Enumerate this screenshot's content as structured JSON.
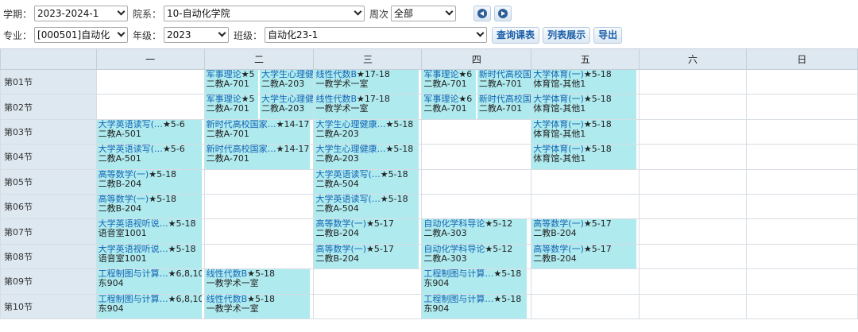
{
  "filters": {
    "term_label": "学期：",
    "term_value": "2023-2024-1",
    "dept_label": "院系：",
    "dept_value": "10-自动化学院",
    "week_label": "周次",
    "week_value": "全部",
    "major_label": "专业：",
    "major_value": "[000501]自动化",
    "grade_label": "年级：",
    "grade_value": "2023",
    "class_label": "班级：",
    "class_value": "自动化23-1",
    "query_btn": "查询课表",
    "list_btn": "列表展示",
    "export_btn": "导出"
  },
  "timetable": {
    "days": [
      "一",
      "二",
      "三",
      "四",
      "五",
      "六",
      "日"
    ],
    "slots": [
      {
        "label": "第01节",
        "cells": [
          [],
          [
            {
              "name": "军事理论",
              "weeks": "★5",
              "room": "二教A-701"
            },
            {
              "name": "大学生心理健",
              "weeks": "",
              "room": "二教A-203"
            }
          ],
          [
            {
              "name": "线性代数B",
              "weeks": "★17-18",
              "room": "一教学术一室"
            }
          ],
          [
            {
              "name": "军事理论",
              "weeks": "★6",
              "room": "二教A-701"
            },
            {
              "name": "新时代高校国",
              "weeks": "",
              "room": "二教A-701"
            }
          ],
          [
            {
              "name": "大学体育(一)",
              "weeks": "★5-18",
              "room": "体育馆-其他1"
            }
          ],
          [],
          []
        ]
      },
      {
        "label": "第02节",
        "cells": [
          [],
          [
            {
              "name": "军事理论",
              "weeks": "★5",
              "room": "二教A-701"
            },
            {
              "name": "大学生心理健",
              "weeks": "",
              "room": "二教A-203"
            }
          ],
          [
            {
              "name": "线性代数B",
              "weeks": "★17-18",
              "room": "一教学术一室"
            }
          ],
          [
            {
              "name": "军事理论",
              "weeks": "★6",
              "room": "二教A-701"
            },
            {
              "name": "新时代高校国",
              "weeks": "",
              "room": "二教A-701"
            }
          ],
          [
            {
              "name": "大学体育(一)",
              "weeks": "★5-18",
              "room": "体育馆-其他1"
            }
          ],
          [],
          []
        ]
      },
      {
        "label": "第03节",
        "cells": [
          [
            {
              "name": "大学英语读写(…",
              "weeks": "★5-6",
              "room": "二教A-501"
            }
          ],
          [
            {
              "name": "新时代高校国家…",
              "weeks": "★14-17",
              "room": "二教A-701"
            }
          ],
          [
            {
              "name": "大学生心理健康…",
              "weeks": "★5-18",
              "room": "二教A-203"
            }
          ],
          [],
          [
            {
              "name": "大学体育(一)",
              "weeks": "★5-18",
              "room": "体育馆-其他1"
            }
          ],
          [],
          []
        ]
      },
      {
        "label": "第04节",
        "cells": [
          [
            {
              "name": "大学英语读写(…",
              "weeks": "★5-6",
              "room": "二教A-501"
            }
          ],
          [
            {
              "name": "新时代高校国家…",
              "weeks": "★14-17",
              "room": "二教A-701"
            }
          ],
          [
            {
              "name": "大学生心理健康…",
              "weeks": "★5-18",
              "room": "二教A-203"
            }
          ],
          [],
          [
            {
              "name": "大学体育(一)",
              "weeks": "★5-18",
              "room": "体育馆-其他1"
            }
          ],
          [],
          []
        ]
      },
      {
        "label": "第05节",
        "cells": [
          [
            {
              "name": "高等数学(一)",
              "weeks": "★5-18",
              "room": "二教B-204"
            }
          ],
          [],
          [
            {
              "name": "大学英语读写(…",
              "weeks": "★5-18",
              "room": "二教A-504"
            }
          ],
          [],
          [],
          [],
          []
        ]
      },
      {
        "label": "第06节",
        "cells": [
          [
            {
              "name": "高等数学(一)",
              "weeks": "★5-18",
              "room": "二教B-204"
            }
          ],
          [],
          [
            {
              "name": "大学英语读写(…",
              "weeks": "★5-18",
              "room": "二教A-504"
            }
          ],
          [],
          [],
          [],
          []
        ]
      },
      {
        "label": "第07节",
        "cells": [
          [
            {
              "name": "大学英语视听说…",
              "weeks": "★5-18",
              "room": "语音室1001"
            }
          ],
          [],
          [
            {
              "name": "高等数学(一)",
              "weeks": "★5-17",
              "room": "二教B-204"
            }
          ],
          [
            {
              "name": "自动化学科导论",
              "weeks": "★5-12",
              "room": "二教A-303"
            }
          ],
          [
            {
              "name": "高等数学(一)",
              "weeks": "★5-17",
              "room": "二教B-204"
            }
          ],
          [],
          []
        ]
      },
      {
        "label": "第08节",
        "cells": [
          [
            {
              "name": "大学英语视听说…",
              "weeks": "★5-18",
              "room": "语音室1001"
            }
          ],
          [],
          [
            {
              "name": "高等数学(一)",
              "weeks": "★5-17",
              "room": "二教B-204"
            }
          ],
          [
            {
              "name": "自动化学科导论",
              "weeks": "★5-12",
              "room": "二教A-303"
            }
          ],
          [
            {
              "name": "高等数学(一)",
              "weeks": "★5-17",
              "room": "二教B-204"
            }
          ],
          [],
          []
        ]
      },
      {
        "label": "第09节",
        "cells": [
          [
            {
              "name": "工程制图与计算…",
              "weeks": "★6,8,10",
              "room": "东904"
            }
          ],
          [
            {
              "name": "线性代数B",
              "weeks": "★5-18",
              "room": "一教学术一室"
            }
          ],
          [],
          [
            {
              "name": "工程制图与计算…",
              "weeks": "★5-18",
              "room": "东904"
            }
          ],
          [],
          [],
          []
        ]
      },
      {
        "label": "第10节",
        "cells": [
          [
            {
              "name": "工程制图与计算…",
              "weeks": "★6,8,10",
              "room": "东904"
            }
          ],
          [
            {
              "name": "线性代数B",
              "weeks": "★5-18",
              "room": "一教学术一室"
            }
          ],
          [],
          [
            {
              "name": "工程制图与计算…",
              "weeks": "★5-18",
              "room": "东904"
            }
          ],
          [],
          [],
          []
        ]
      }
    ]
  }
}
